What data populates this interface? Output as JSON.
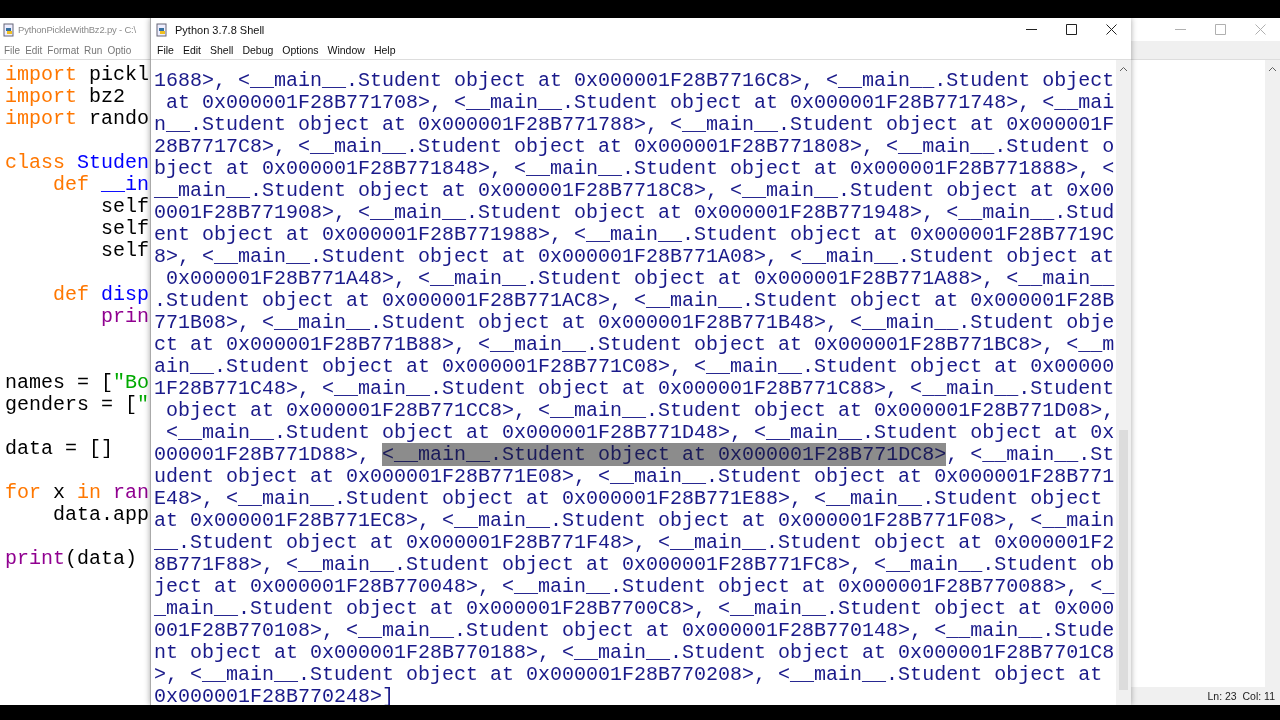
{
  "editor": {
    "title": "PythonPickleWithBz2.py - C:\\",
    "menu": [
      "File",
      "Edit",
      "Format",
      "Run",
      "Optio"
    ],
    "lines": [
      {
        "kind": "code",
        "tokens": [
          {
            "kind": "keyword",
            "t": "import"
          },
          {
            "kind": "plain",
            "t": " pickl"
          }
        ]
      },
      {
        "kind": "code",
        "tokens": [
          {
            "kind": "keyword",
            "t": "import"
          },
          {
            "kind": "plain",
            "t": " bz2"
          }
        ]
      },
      {
        "kind": "code",
        "tokens": [
          {
            "kind": "keyword",
            "t": "import"
          },
          {
            "kind": "plain",
            "t": " rando"
          }
        ]
      },
      {
        "kind": "blank"
      },
      {
        "kind": "code",
        "tokens": [
          {
            "kind": "keyword",
            "t": "class"
          },
          {
            "kind": "name",
            "t": " Studen"
          }
        ]
      },
      {
        "kind": "code",
        "tokens": [
          {
            "kind": "keyword",
            "t": "    def"
          },
          {
            "kind": "name",
            "t": " __in"
          }
        ]
      },
      {
        "kind": "code",
        "tokens": [
          {
            "kind": "plain",
            "t": "        self"
          }
        ]
      },
      {
        "kind": "code",
        "tokens": [
          {
            "kind": "plain",
            "t": "        self"
          }
        ]
      },
      {
        "kind": "code",
        "tokens": [
          {
            "kind": "plain",
            "t": "        self"
          }
        ]
      },
      {
        "kind": "blank"
      },
      {
        "kind": "code",
        "tokens": [
          {
            "kind": "keyword",
            "t": "    def"
          },
          {
            "kind": "name",
            "t": " disp"
          }
        ]
      },
      {
        "kind": "code",
        "tokens": [
          {
            "kind": "builtin",
            "t": "        prin"
          }
        ]
      },
      {
        "kind": "blank"
      },
      {
        "kind": "blank"
      },
      {
        "kind": "code",
        "tokens": [
          {
            "kind": "plain",
            "t": "names = ["
          },
          {
            "kind": "string",
            "t": "\"Bo"
          }
        ]
      },
      {
        "kind": "code",
        "tokens": [
          {
            "kind": "plain",
            "t": "genders = ["
          },
          {
            "kind": "string",
            "t": "\""
          }
        ]
      },
      {
        "kind": "blank"
      },
      {
        "kind": "code",
        "tokens": [
          {
            "kind": "plain",
            "t": "data = []"
          }
        ]
      },
      {
        "kind": "blank"
      },
      {
        "kind": "code",
        "tokens": [
          {
            "kind": "keyword",
            "t": "for"
          },
          {
            "kind": "plain",
            "t": " x "
          },
          {
            "kind": "keyword",
            "t": "in"
          },
          {
            "kind": "builtin",
            "t": " ran"
          }
        ]
      },
      {
        "kind": "code",
        "tokens": [
          {
            "kind": "plain",
            "t": "    data.app"
          }
        ]
      },
      {
        "kind": "blank"
      },
      {
        "kind": "code",
        "tokens": [
          {
            "kind": "builtin",
            "t": "print"
          },
          {
            "kind": "plain",
            "t": "(data)"
          }
        ]
      }
    ]
  },
  "shell": {
    "title": "Python 3.7.8 Shell",
    "menu": [
      "File",
      "Edit",
      "Shell",
      "Debug",
      "Options",
      "Window",
      "Help"
    ],
    "lines": [
      {
        "text": "1688>, <__main__.Student object at 0x000001F28B7716C8>, <__main__.Student object"
      },
      {
        "text": " at 0x000001F28B771708>, <__main__.Student object at 0x000001F28B771748>, <__mai"
      },
      {
        "text": "n__.Student object at 0x000001F28B771788>, <__main__.Student object at 0x000001F"
      },
      {
        "text": "28B7717C8>, <__main__.Student object at 0x000001F28B771808>, <__main__.Student o"
      },
      {
        "text": "bject at 0x000001F28B771848>, <__main__.Student object at 0x000001F28B771888>, <"
      },
      {
        "text": "__main__.Student object at 0x000001F28B7718C8>, <__main__.Student object at 0x00"
      },
      {
        "text": "0001F28B771908>, <__main__.Student object at 0x000001F28B771948>, <__main__.Stud"
      },
      {
        "text": "ent object at 0x000001F28B771988>, <__main__.Student object at 0x000001F28B7719C"
      },
      {
        "text": "8>, <__main__.Student object at 0x000001F28B771A08>, <__main__.Student object at"
      },
      {
        "text": " 0x000001F28B771A48>, <__main__.Student object at 0x000001F28B771A88>, <__main__"
      },
      {
        "text": ".Student object at 0x000001F28B771AC8>, <__main__.Student object at 0x000001F28B"
      },
      {
        "text": "771B08>, <__main__.Student object at 0x000001F28B771B48>, <__main__.Student obje"
      },
      {
        "text": "ct at 0x000001F28B771B88>, <__main__.Student object at 0x000001F28B771BC8>, <__m"
      },
      {
        "text": "ain__.Student object at 0x000001F28B771C08>, <__main__.Student object at 0x00000"
      },
      {
        "text": "1F28B771C48>, <__main__.Student object at 0x000001F28B771C88>, <__main__.Student"
      },
      {
        "text": " object at 0x000001F28B771CC8>, <__main__.Student object at 0x000001F28B771D08>,"
      },
      {
        "text": " <__main__.Student object at 0x000001F28B771D48>, <__main__.Student object at 0x"
      },
      {
        "text": "000001F28B771D88>, ",
        "selected_text": "<__main__.Student object at 0x000001F28B771DC8>",
        "after": ", <__main__.St"
      },
      {
        "text": "udent object at 0x000001F28B771E08>, <__main__.Student object at 0x000001F28B771"
      },
      {
        "text": "E48>, <__main__.Student object at 0x000001F28B771E88>, <__main__.Student object"
      },
      {
        "text": "at 0x000001F28B771EC8>, <__main__.Student object at 0x000001F28B771F08>, <__main"
      },
      {
        "text": "__.Student object at 0x000001F28B771F48>, <__main__.Student object at 0x000001F2"
      },
      {
        "text": "8B771F88>, <__main__.Student object at 0x000001F28B771FC8>, <__main__.Student ob"
      },
      {
        "text": "ject at 0x000001F28B770048>, <__main__.Student object at 0x000001F28B770088>, <_"
      },
      {
        "text": "_main__.Student object at 0x000001F28B7700C8>, <__main__.Student object at 0x000"
      },
      {
        "text": "001F28B770108>, <__main__.Student object at 0x000001F28B770148>, <__main__.Stude"
      },
      {
        "text": "nt object at 0x000001F28B770188>, <__main__.Student object at 0x000001F28B7701C8"
      },
      {
        "text": ">, <__main__.Student object at 0x000001F28B770208>, <__main__.Student object at"
      },
      {
        "text": "0x000001F28B770248>]"
      }
    ]
  },
  "back_window": {
    "status": "Ln: 23  Col: 11"
  }
}
